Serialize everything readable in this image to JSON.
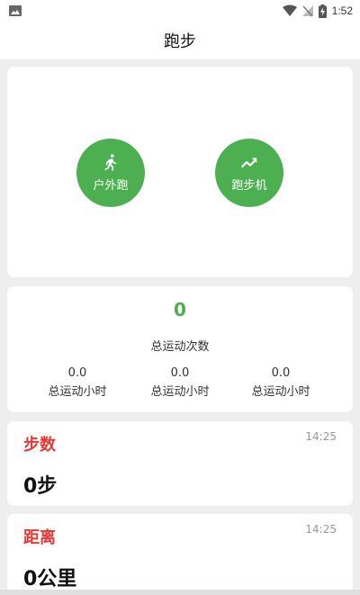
{
  "status_bar": {
    "time": "1:52",
    "icons": [
      "image-icon",
      "wifi-icon",
      "no-signal-icon",
      "battery-charging-icon"
    ]
  },
  "app_bar": {
    "title": "跑步"
  },
  "modes": {
    "outdoor": {
      "label": "户外跑",
      "icon": "running-person-icon"
    },
    "treadmill": {
      "label": "跑步机",
      "icon": "trending-up-icon"
    }
  },
  "stats": {
    "total_count": "0",
    "total_count_label": "总运动次数",
    "columns": [
      {
        "value": "0.0",
        "label": "总运动小时"
      },
      {
        "value": "0.0",
        "label": "总运动小时"
      },
      {
        "value": "0.0",
        "label": "总运动小时"
      }
    ]
  },
  "metrics": {
    "steps": {
      "title": "步数",
      "time": "14:25",
      "value": "0步"
    },
    "distance": {
      "title": "距离",
      "time": "14:25",
      "value": "0公里"
    }
  },
  "colors": {
    "accent_green": "#4caf50",
    "metric_title_red": "#e53935",
    "background": "#eeeeee"
  }
}
